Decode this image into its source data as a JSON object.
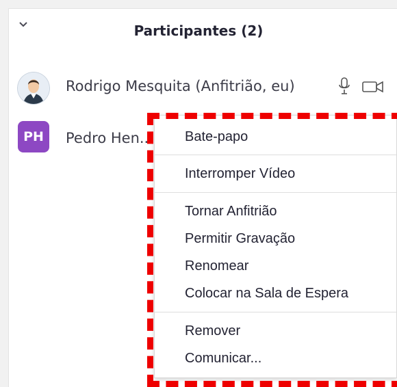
{
  "header": {
    "title": "Participantes (2)"
  },
  "participants": [
    {
      "name": "Rodrigo Mesquita (Anfitrião, eu)",
      "avatar": "user-photo"
    },
    {
      "name": "Pedro Hen...",
      "initials": "PH",
      "avatar_color": "#8d48c3"
    }
  ],
  "context_menu": {
    "items": [
      "Bate-papo",
      "Interromper Vídeo",
      "Tornar Anfitrião",
      "Permitir Gravação",
      "Renomear",
      "Colocar na Sala de Espera",
      "Remover",
      "Comunicar..."
    ]
  },
  "colors": {
    "highlight": "#ee0000",
    "avatar_purple": "#8d48c3",
    "text": "#232333"
  },
  "icons": [
    "chevron-down-icon",
    "microphone-icon",
    "video-camera-icon",
    "user-avatar-icon"
  ]
}
